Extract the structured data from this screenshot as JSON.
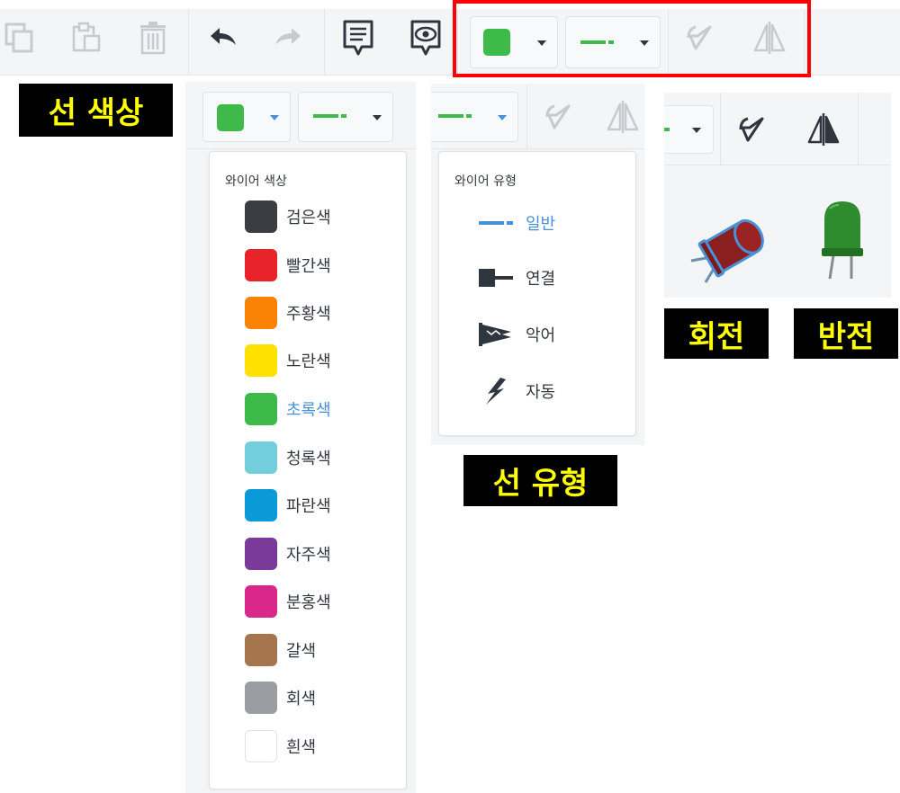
{
  "toolbar": {
    "icons": [
      "copy-icon",
      "paste-icon",
      "delete-icon",
      "undo-icon",
      "redo-icon",
      "note-icon",
      "preview-icon"
    ],
    "wire_color_hex": "#3dba4a",
    "rotate_icon": "rotate-icon",
    "flip_icon": "flip-icon"
  },
  "labels": {
    "line_color": "선 색상",
    "line_type": "선 유형",
    "rotate": "회전",
    "flip": "반전"
  },
  "color_menu": {
    "title": "와이어 색상",
    "selected": "초록색",
    "items": [
      {
        "name": "검은색",
        "hex": "#3a3d42"
      },
      {
        "name": "빨간색",
        "hex": "#e8242a"
      },
      {
        "name": "주황색",
        "hex": "#fa8205"
      },
      {
        "name": "노란색",
        "hex": "#ffe100"
      },
      {
        "name": "초록색",
        "hex": "#3dba4a"
      },
      {
        "name": "청록색",
        "hex": "#72cedb"
      },
      {
        "name": "파란색",
        "hex": "#0a9ad9"
      },
      {
        "name": "자주색",
        "hex": "#7a3a9a"
      },
      {
        "name": "분홍색",
        "hex": "#d9278a"
      },
      {
        "name": "갈색",
        "hex": "#a5764e"
      },
      {
        "name": "회색",
        "hex": "#9a9da1"
      },
      {
        "name": "흰색",
        "hex": "#ffffff"
      }
    ]
  },
  "type_menu": {
    "title": "와이어 유형",
    "selected": "일반",
    "items": [
      {
        "name": "일반",
        "icon": "normal-wire-icon"
      },
      {
        "name": "연결",
        "icon": "connection-wire-icon"
      },
      {
        "name": "악어",
        "icon": "alligator-wire-icon"
      },
      {
        "name": "자동",
        "icon": "auto-wire-icon"
      }
    ]
  },
  "preview": {
    "rotated_led": "red-led-rotated",
    "flipped_led": "green-led"
  }
}
